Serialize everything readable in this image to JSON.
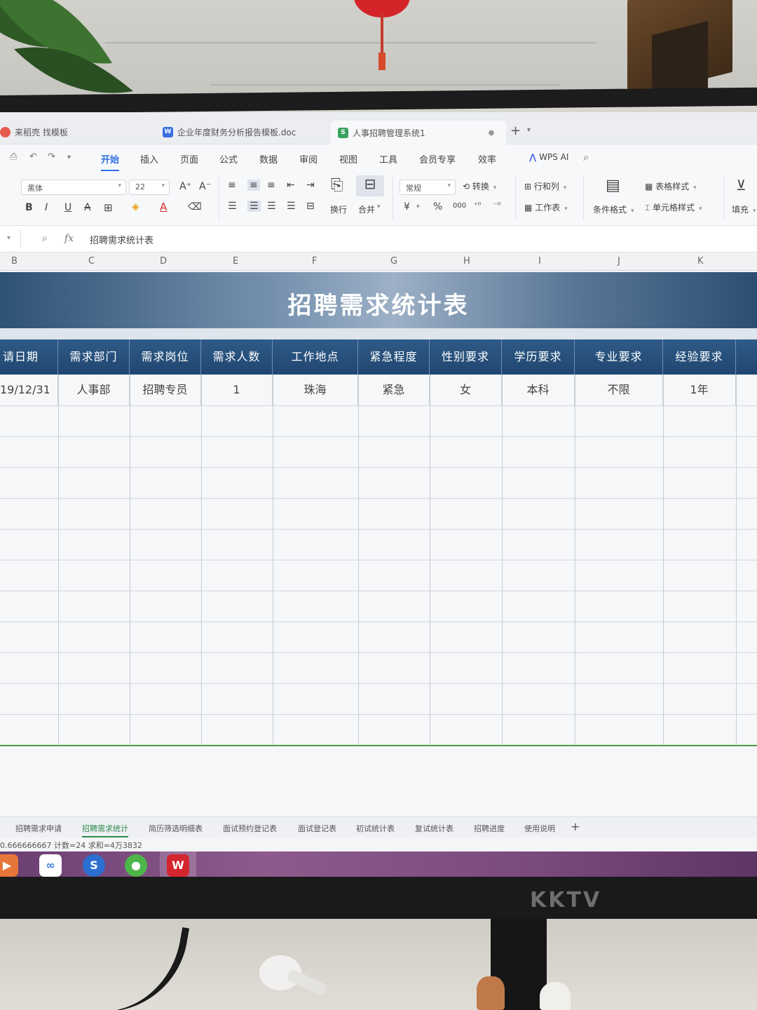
{
  "window_tabs": [
    {
      "label": "来稻壳 找模板",
      "icon": "wps-red-icon"
    },
    {
      "label": "企业年度财务分析报告模板.doc",
      "icon": "word-doc-icon"
    },
    {
      "label": "人事招聘管理系统1",
      "icon": "sheet-doc-icon",
      "active": true
    }
  ],
  "ribbon_tabs": [
    "开始",
    "插入",
    "页面",
    "公式",
    "数据",
    "审阅",
    "视图",
    "工具",
    "会员专享",
    "效率"
  ],
  "ribbon_active": "开始",
  "wps_ai_label": "WPS AI",
  "toolbar": {
    "font_name": "黑体",
    "font_size": "22",
    "wrap_label": "换行",
    "merge_label": "合并",
    "number_format": "常规",
    "convert_label": "转换",
    "rowcol_label": "行和列",
    "worksheet_label": "工作表",
    "cond_format_label": "条件格式",
    "table_style_label": "表格样式",
    "cell_style_label": "单元格样式",
    "fill_label": "填充",
    "currency_symbol": "¥",
    "percent_symbol": "%",
    "thousands_symbol": "000",
    "bold": "B",
    "italic": "I",
    "underline": "U",
    "strike": "A"
  },
  "formula_bar": {
    "fx_label": "fx",
    "content": "招聘需求统计表"
  },
  "columns": [
    "B",
    "C",
    "D",
    "E",
    "F",
    "G",
    "H",
    "I",
    "J",
    "K"
  ],
  "sheet": {
    "title": "招聘需求统计表",
    "headers": [
      "请日期",
      "需求部门",
      "需求岗位",
      "需求人数",
      "工作地点",
      "紧急程度",
      "性别要求",
      "学历要求",
      "专业要求",
      "经验要求"
    ],
    "rows": [
      [
        "19/12/31",
        "人事部",
        "招聘专员",
        "1",
        "珠海",
        "紧急",
        "女",
        "本科",
        "不限",
        "1年"
      ]
    ]
  },
  "sheet_tabs": [
    "招聘需求申请",
    "招聘需求统计",
    "简历筛选明细表",
    "面试预约登记表",
    "面试登记表",
    "初试统计表",
    "复试统计表",
    "招聘进度",
    "使用说明"
  ],
  "active_sheet": "招聘需求统计",
  "status_bar": "0.666666667  计数=24  求和=4万3832",
  "monitor_brand": "KKTV",
  "colors": {
    "header_blue": "#1f4670",
    "accent_green": "#2e8b4f",
    "ribbon_blue": "#2f6fe4",
    "taskbar_purple": "#7b4a7e"
  }
}
